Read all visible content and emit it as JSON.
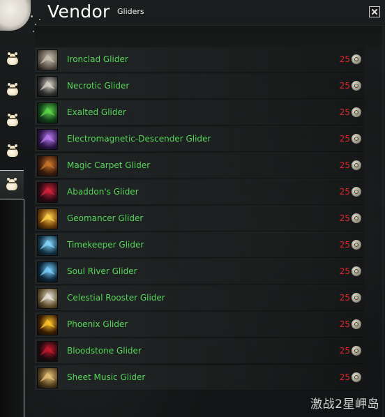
{
  "window": {
    "title": "Vendor",
    "subtitle": "Gliders",
    "close_icon": "close-icon"
  },
  "tabs": [
    {
      "icon": "bag-icon",
      "active": false
    },
    {
      "icon": "bag-icon",
      "active": false
    },
    {
      "icon": "bag-icon",
      "active": false
    },
    {
      "icon": "bag-icon",
      "active": false
    },
    {
      "icon": "bag-icon",
      "active": true
    }
  ],
  "items": [
    {
      "name": "Ironclad Glider",
      "price": "25",
      "icon": "ironclad-glider-icon",
      "colors": [
        "#c9c2b2",
        "#5a5148"
      ]
    },
    {
      "name": "Necrotic Glider",
      "price": "25",
      "icon": "necrotic-glider-icon",
      "colors": [
        "#d8d3c8",
        "#2e2e2e"
      ]
    },
    {
      "name": "Exalted Glider",
      "price": "25",
      "icon": "exalted-glider-icon",
      "colors": [
        "#5fd64a",
        "#0f3c18"
      ]
    },
    {
      "name": "Electromagnetic-Descender Glider",
      "price": "25",
      "icon": "electromagnetic-descender-glider-icon",
      "colors": [
        "#b77bf0",
        "#2b1446"
      ]
    },
    {
      "name": "Magic Carpet Glider",
      "price": "25",
      "icon": "magic-carpet-glider-icon",
      "colors": [
        "#c8762b",
        "#3a1a0c"
      ]
    },
    {
      "name": "Abaddon's Glider",
      "price": "25",
      "icon": "abaddons-glider-icon",
      "colors": [
        "#d0213a",
        "#2a0a12"
      ]
    },
    {
      "name": "Geomancer Glider",
      "price": "25",
      "icon": "geomancer-glider-icon",
      "colors": [
        "#ffd34d",
        "#6a3a06"
      ]
    },
    {
      "name": "Timekeeper Glider",
      "price": "25",
      "icon": "timekeeper-glider-icon",
      "colors": [
        "#86d6ff",
        "#123243"
      ]
    },
    {
      "name": "Soul River Glider",
      "price": "25",
      "icon": "soul-river-glider-icon",
      "colors": [
        "#7ad0ff",
        "#0b2436"
      ]
    },
    {
      "name": "Celestial Rooster Glider",
      "price": "25",
      "icon": "celestial-rooster-glider-icon",
      "colors": [
        "#e8e4da",
        "#5d4c2a"
      ]
    },
    {
      "name": "Phoenix Glider",
      "price": "25",
      "icon": "phoenix-glider-icon",
      "colors": [
        "#ffc42a",
        "#3a1d04"
      ]
    },
    {
      "name": "Bloodstone Glider",
      "price": "25",
      "icon": "bloodstone-glider-icon",
      "colors": [
        "#c2182c",
        "#1b0a0e"
      ]
    },
    {
      "name": "Sheet Music Glider",
      "price": "25",
      "icon": "sheet-music-glider-icon",
      "colors": [
        "#e6c27a",
        "#4f3a1a"
      ]
    }
  ],
  "currency": {
    "icon": "token-icon"
  },
  "watermark": "激战2星岬岛",
  "theme": {
    "item_name_color": "#57d65a",
    "price_color": "#e0242a",
    "title_color": "#ffffff"
  }
}
